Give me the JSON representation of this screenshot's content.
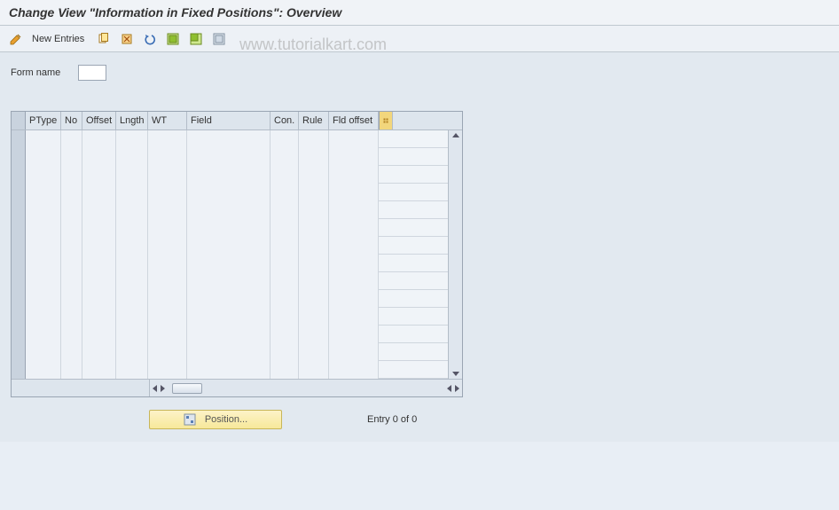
{
  "title": "Change View \"Information in Fixed Positions\": Overview",
  "toolbar": {
    "new_entries_label": "New Entries"
  },
  "watermark": "www.tutorialkart.com",
  "form": {
    "name_label": "Form name",
    "name_value": ""
  },
  "grid": {
    "columns": {
      "ptype": "PType",
      "no": "No",
      "offset": "Offset",
      "lngth": "Lngth",
      "wt": "WT",
      "field": "Field",
      "con": "Con.",
      "rule": "Rule",
      "fldoff": "Fld offset"
    },
    "rows": []
  },
  "footer": {
    "position_label": "Position...",
    "entry_status": "Entry 0 of 0"
  }
}
